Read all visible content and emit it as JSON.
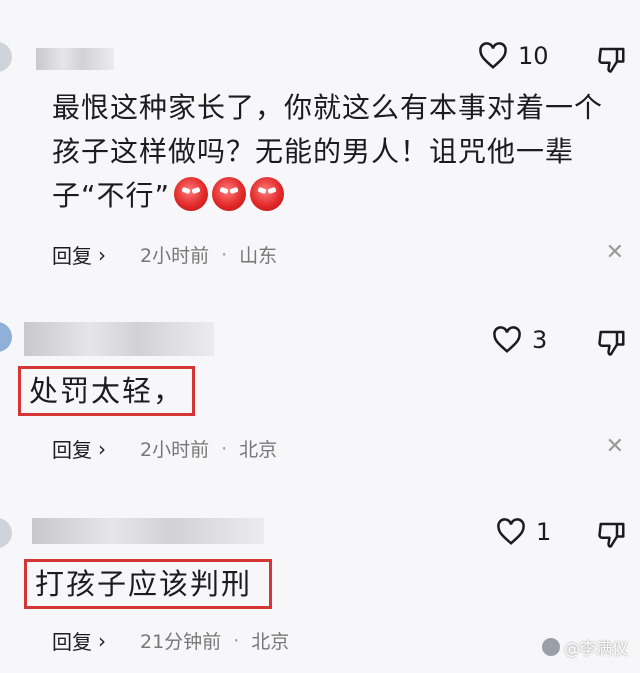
{
  "comments": [
    {
      "likes": "10",
      "text": "最恨这种家长了，你就这么有本事对着一个孩子这样做吗？无能的男人！诅咒他一辈子“不行”",
      "emoji_count": "3",
      "reply_label": "回复",
      "time": "2小时前",
      "location": "山东"
    },
    {
      "likes": "3",
      "text": "处罚太轻，",
      "reply_label": "回复",
      "time": "2小时前",
      "location": "北京"
    },
    {
      "likes": "1",
      "text": "打孩子应该判刑",
      "reply_label": "回复",
      "time": "21分钟前",
      "location": "北京"
    }
  ],
  "separator": "·",
  "watermark": "@李满仪",
  "colors": {
    "highlight_box": "#d43535",
    "meta_text": "#777777"
  },
  "icons": [
    "heart-icon",
    "thumbs-down-icon",
    "chevron-right-icon",
    "close-icon",
    "angry-emoji-icon"
  ]
}
